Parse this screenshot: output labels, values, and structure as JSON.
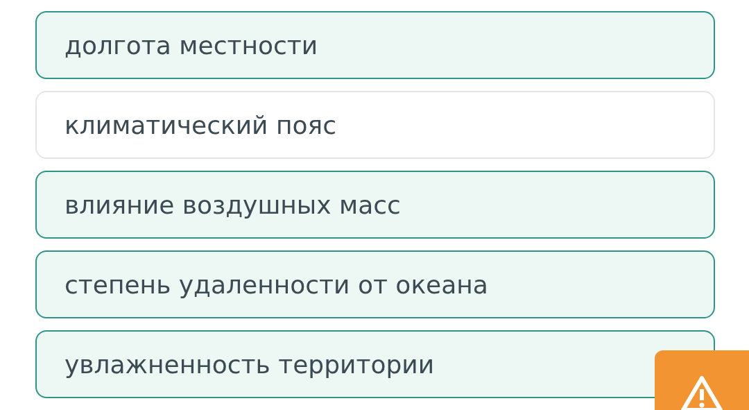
{
  "options": [
    {
      "label": "долгота местности",
      "selected": true
    },
    {
      "label": "климатический пояс",
      "selected": false
    },
    {
      "label": "влияние воздушных масс",
      "selected": true
    },
    {
      "label": "степень удаленности от океана",
      "selected": true
    },
    {
      "label": "увлажненность территории",
      "selected": true
    }
  ],
  "report_button": {
    "kind": "warning"
  }
}
